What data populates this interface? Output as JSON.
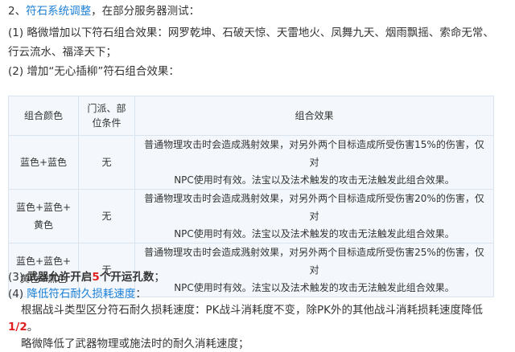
{
  "section": {
    "num": "2、",
    "title": "符石系统调整",
    "rest": "，在部分服务器测试："
  },
  "item1": {
    "line1": "(1) 略微增加以下符石组合效果：网罗乾坤、石破天惊、天雷地火、凤舞九天、烟雨飘摇、索命无常、",
    "line2": "行云流水、福泽天下；"
  },
  "item2": "(2) 增加“无心插柳”符石组合效果：",
  "table": {
    "headers": {
      "color": "组合颜色",
      "cond_line1": "门派、部",
      "cond_line2": "位条件",
      "effect": "组合效果"
    },
    "rows": [
      {
        "color_line1": "蓝色+蓝色",
        "color_line2": "",
        "condition": "无",
        "effect_line1": "普通物理攻击时会造成溅射效果，对另外两个目标造成所受伤害15%的伤害，仅对",
        "effect_line2": "NPC使用时有效。法宝以及法术触发的攻击无法触发此组合效果。"
      },
      {
        "color_line1": "蓝色+蓝色+",
        "color_line2": "黄色",
        "condition": "无",
        "effect_line1": "普通物理攻击时会造成溅射效果，对另外两个目标造成所受伤害20%的伤害，仅对",
        "effect_line2": "NPC使用时有效。法宝以及法术触发的攻击无法触发此组合效果。"
      },
      {
        "color_line1": "蓝色+蓝色+",
        "color_line2": "黄色+黑色",
        "condition": "无",
        "effect_line1": "普通物理攻击时会造成溅射效果，对另外两个目标造成所受伤害25%的伤害，仅对",
        "effect_line2": "NPC使用时有效。法宝以及法术触发的攻击无法触发此组合效果。"
      }
    ]
  },
  "item3": {
    "prefix": "(3) ",
    "bold_a": "武器允许开启",
    "num": "5",
    "bold_b": "个开运孔数",
    "suffix": "；"
  },
  "item4": {
    "prefix": "(4) ",
    "title": "降低符石耐久损耗速度",
    "suffix": "：",
    "desc_line1": "根据战斗类型区分符石耐久损耗速度：PK战斗消耗度不变，除PK外的其他战斗消耗损耗速度降低",
    "fraction": "1/2",
    "desc_end": "。",
    "cut_line": "略微降低了武器物理或施法时的耐久消耗速度；"
  },
  "colors": {
    "link_blue": "#1b7fd6",
    "highlight_red": "#e02020",
    "table_bg": "#f4f8fc",
    "table_border": "#d9e4ef"
  }
}
